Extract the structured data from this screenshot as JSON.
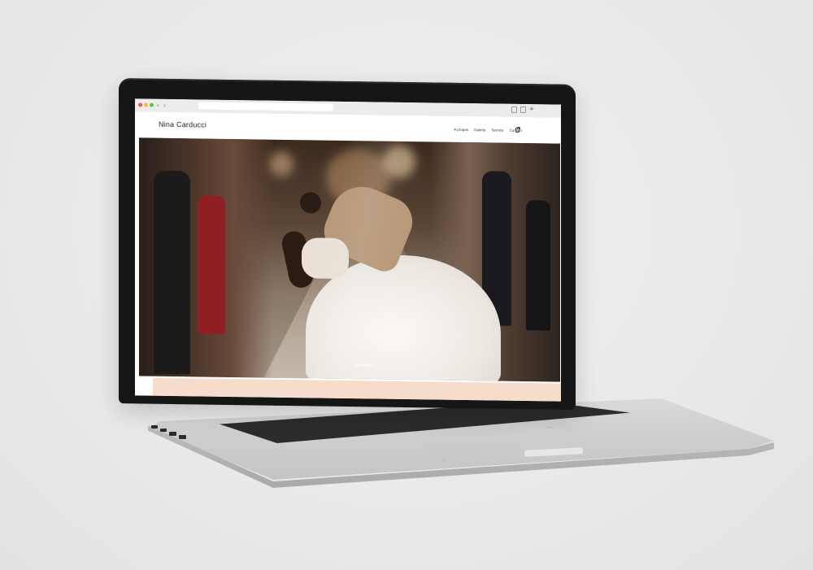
{
  "browser": {
    "traffic_lights": [
      "#ec5b55",
      "#f2bb41",
      "#5bc24b"
    ],
    "back_glyph": "‹",
    "forward_glyph": "›",
    "new_tab_glyph": "+"
  },
  "site": {
    "title": "Nina Carducci",
    "nav": [
      "A propos",
      "Galerie",
      "Service",
      "Contact"
    ]
  },
  "colors": {
    "accent_strip": "#f6dccb",
    "laptop_bezel": "#161616"
  }
}
